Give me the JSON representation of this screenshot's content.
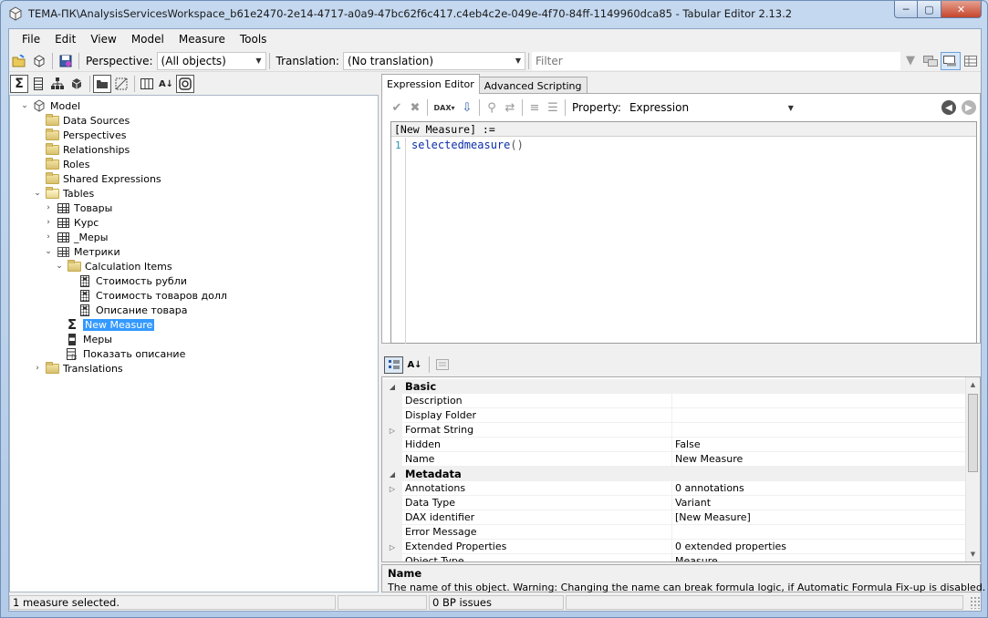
{
  "window": {
    "title": "TEMA-ПК\\AnalysisServicesWorkspace_b61e2470-2e14-4717-a0a9-47bc62f6c417.c4eb4c2e-049e-4f70-84ff-1149960dca85 - Tabular Editor 2.13.2",
    "min": "─",
    "max": "▢",
    "close": "✕"
  },
  "menu": {
    "file": "File",
    "edit": "Edit",
    "view": "View",
    "model": "Model",
    "measure": "Measure",
    "tools": "Tools"
  },
  "toolbar": {
    "perspective_label": "Perspective:",
    "perspective_value": "(All objects)",
    "translation_label": "Translation:",
    "translation_value": "(No translation)",
    "filter_placeholder": "Filter"
  },
  "tree": {
    "model": "Model",
    "data_sources": "Data Sources",
    "perspectives": "Perspectives",
    "relationships": "Relationships",
    "roles": "Roles",
    "shared_expressions": "Shared Expressions",
    "tables": "Tables",
    "table_goods": "Товары",
    "table_rate": "Курс",
    "table_measures": "_Меры",
    "table_metrics": "Метрики",
    "calc_items": "Calculation Items",
    "calc_item_1": "Стоимость рубли",
    "calc_item_2": "Стоимость товаров долл",
    "calc_item_3": "Описание товара",
    "new_measure": "New Measure",
    "measures": "Меры",
    "show_description": "Показать описание",
    "translations": "Translations"
  },
  "editor": {
    "tab_expression": "Expression Editor",
    "tab_scripting": "Advanced Scripting",
    "property_label": "Property:",
    "property_value": "Expression",
    "header": "[New Measure] :=",
    "line_number": "1",
    "code_fn": "selectedmeasure",
    "code_paren": "()"
  },
  "properties": {
    "cat_basic": "Basic",
    "description": "Description",
    "display_folder": "Display Folder",
    "format_string": "Format String",
    "hidden": "Hidden",
    "hidden_value": "False",
    "name": "Name",
    "name_value": "New Measure",
    "cat_metadata": "Metadata",
    "annotations": "Annotations",
    "annotations_value": "0 annotations",
    "data_type": "Data Type",
    "data_type_value": "Variant",
    "dax_identifier": "DAX identifier",
    "dax_identifier_value": "[New Measure]",
    "error_message": "Error Message",
    "extended_properties": "Extended Properties",
    "extended_properties_value": "0 extended properties",
    "object_type": "Object Type",
    "object_type_value": "Measure"
  },
  "description_panel": {
    "title": "Name",
    "text": "The name of this object. Warning: Changing the name can break formula logic, if Automatic Formula Fix-up is disabled."
  },
  "status": {
    "selection": "1 measure selected.",
    "bp_issues": "0 BP issues"
  }
}
